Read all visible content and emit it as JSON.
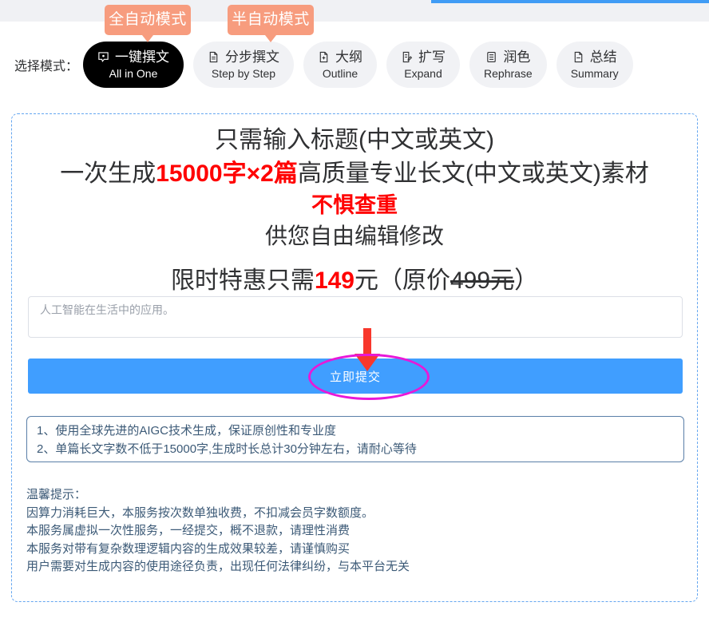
{
  "callouts": {
    "auto": "全自动模式",
    "semi": "半自动模式"
  },
  "mode_selector": {
    "label": "选择模式：",
    "modes": [
      {
        "cn": "一键撰文",
        "en": "All in One",
        "icon": "comment-dot-icon",
        "active": true
      },
      {
        "cn": "分步撰文",
        "en": "Step by Step",
        "icon": "document-lines-icon",
        "active": false
      },
      {
        "cn": "大纲",
        "en": "Outline",
        "icon": "document-plus-icon",
        "active": false
      },
      {
        "cn": "扩写",
        "en": "Expand",
        "icon": "document-edit-icon",
        "active": false
      },
      {
        "cn": "润色",
        "en": "Rephrase",
        "icon": "document-list-icon",
        "active": false
      },
      {
        "cn": "总结",
        "en": "Summary",
        "icon": "document-page-icon",
        "active": false
      }
    ]
  },
  "promo": {
    "line1": "只需输入标题(中文或英文)",
    "line2_a": "一次生成",
    "line2_highlight": "15000字×2篇",
    "line2_b": "高质量专业长文(中文或英文)素材",
    "line3": "不惧查重",
    "line4": "供您自由编辑修改",
    "price_a": "限时特惠只需",
    "price_amount": "149",
    "price_b": "元（原价",
    "price_original": "499元",
    "price_c": "）"
  },
  "title_input": {
    "placeholder": "人工智能在生活中的应用。",
    "value": ""
  },
  "submit": {
    "label": "立即提交"
  },
  "notes": [
    "1、使用全球先进的AIGC技术生成，保证原创性和专业度",
    "2、单篇长文字数不低于15000字,生成时长总计30分钟左右，请耐心等待"
  ],
  "tips": [
    "温馨提示：",
    "因算力消耗巨大，本服务按次数单独收费，不扣减会员字数额度。",
    "本服务属虚拟一次性服务，一经提交，概不退款，请理性消费",
    "本服务对带有复杂数理逻辑内容的生成效果较差，请谨慎购买",
    "用户需要对生成内容的使用途径负责，出现任何法律纠纷，与本平台无关"
  ],
  "colors": {
    "accent_blue": "#409eff",
    "callout_orange": "#f79c7e",
    "highlight_magenta": "#e818d8",
    "arrow_red": "#f8372c",
    "promo_red": "#ff0000",
    "note_text": "#3c5a77"
  }
}
